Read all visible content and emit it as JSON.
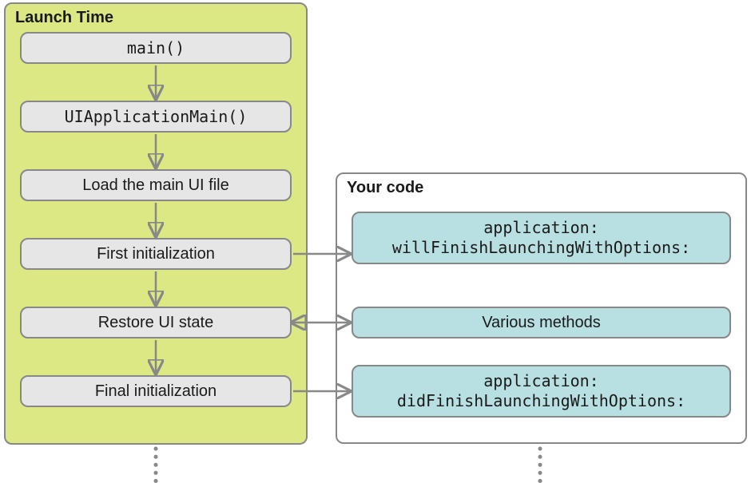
{
  "panels": {
    "launch": {
      "title": "Launch Time"
    },
    "code": {
      "title": "Your code"
    }
  },
  "nodes": {
    "main": "main()",
    "uiapp": "UIApplicationMain()",
    "loadui": "Load the main UI file",
    "firstinit": "First initialization",
    "restore": "Restore UI state",
    "finalinit": "Final initialization",
    "willfinish": "application:\nwillFinishLaunchingWithOptions:",
    "various": "Various methods",
    "didfinish": "application:\ndidFinishLaunchingWithOptions:"
  },
  "colors": {
    "panelBorder": "#888888",
    "launchBg": "#dce883",
    "codeBg": "#ffffff",
    "grayNode": "#e6e6e6",
    "blueNode": "#b8e0e2",
    "arrow": "#888888",
    "dotted": "#888888"
  },
  "flow": {
    "launch_sequence": [
      "main",
      "uiapp",
      "loadui",
      "firstinit",
      "restore",
      "finalinit"
    ],
    "cross_links": [
      {
        "from": "firstinit",
        "to": "willfinish",
        "bidirectional": false
      },
      {
        "from": "restore",
        "to": "various",
        "bidirectional": true
      },
      {
        "from": "finalinit",
        "to": "didfinish",
        "bidirectional": false
      }
    ]
  }
}
